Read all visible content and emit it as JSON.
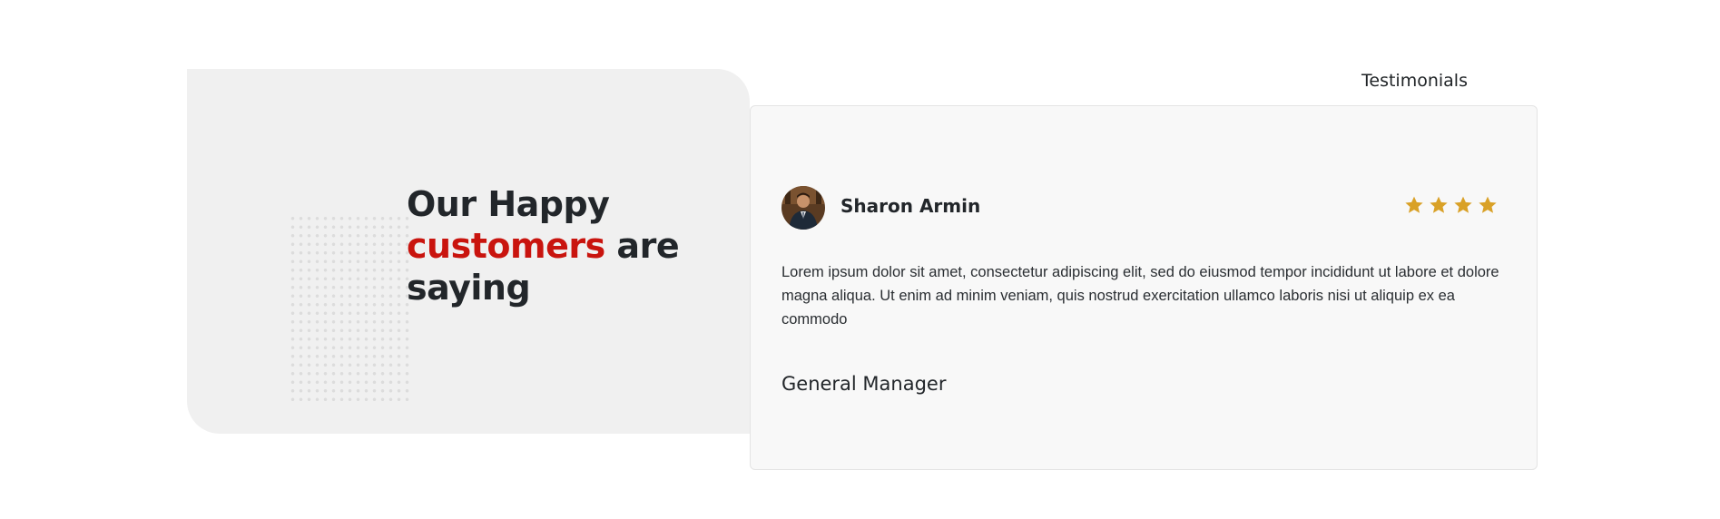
{
  "section": {
    "label": "Testimonials"
  },
  "headline": {
    "line1": "Our Happy",
    "accent_word": "customers",
    "line2_rest": " are",
    "line3": "saying"
  },
  "testimonial": {
    "name": "Sharon Armin",
    "rating": 4,
    "rating_max": 4,
    "text": "Lorem ipsum dolor sit amet, consectetur adipiscing elit, sed do eiusmod tempor incididunt ut labore et dolore magna aliqua. Ut enim ad minim veniam, quis nostrud exercitation ullamco laboris nisi ut aliquip ex ea commodo",
    "role": "General Manager",
    "avatar_icon": "person-photo"
  },
  "colors": {
    "accent": "#c9140e",
    "star": "#d9a127",
    "panel_bg": "#f0f0f0",
    "card_bg": "#f8f8f8"
  }
}
